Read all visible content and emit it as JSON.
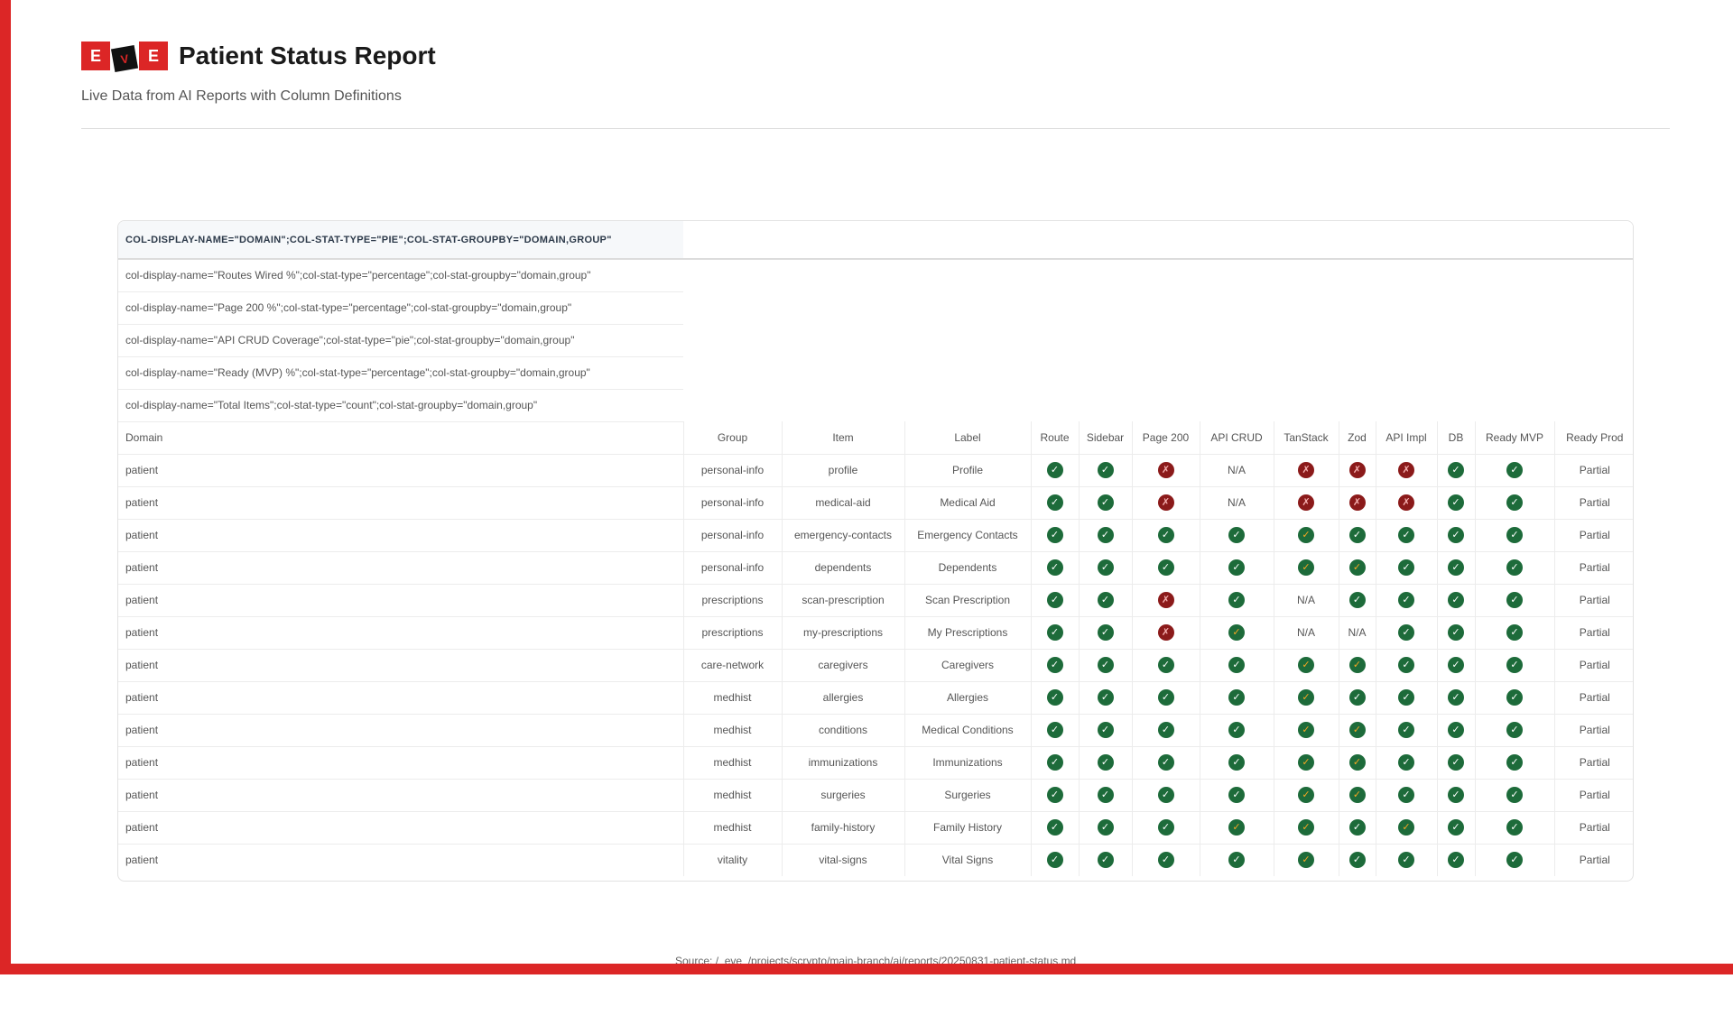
{
  "header": {
    "logo_letters": [
      "E",
      "V",
      "E"
    ],
    "title": "Patient Status Report",
    "subtitle": "Live Data from AI Reports with Column Definitions"
  },
  "table": {
    "definition_header": "COL-DISPLAY-NAME=\"DOMAIN\";COL-STAT-TYPE=\"PIE\";COL-STAT-GROUPBY=\"DOMAIN,GROUP\"",
    "definitions": [
      "col-display-name=\"Routes Wired %\";col-stat-type=\"percentage\";col-stat-groupby=\"domain,group\"",
      "col-display-name=\"Page 200 %\";col-stat-type=\"percentage\";col-stat-groupby=\"domain,group\"",
      "col-display-name=\"API CRUD Coverage\";col-stat-type=\"pie\";col-stat-groupby=\"domain,group\"",
      "col-display-name=\"Ready (MVP) %\";col-stat-type=\"percentage\";col-stat-groupby=\"domain,group\"",
      "col-display-name=\"Total Items\";col-stat-type=\"count\";col-stat-groupby=\"domain,group\""
    ],
    "columns": [
      "Domain",
      "Group",
      "Item",
      "Label",
      "Route",
      "Sidebar",
      "Page 200",
      "API CRUD",
      "TanStack",
      "Zod",
      "API Impl",
      "DB",
      "Ready MVP",
      "Ready Prod"
    ],
    "status_legend": {
      "g": "pass",
      "o": "pass-partial",
      "r": "fail"
    },
    "colors": {
      "accent": "#dc2626",
      "pass": "#1d6b3a",
      "fail": "#8b1a1a",
      "partial": "#e8741c"
    },
    "rows": [
      {
        "domain": "patient",
        "group": "personal-info",
        "item": "profile",
        "label": "Profile",
        "status": [
          "g",
          "g",
          "r",
          "N/A",
          "r",
          "r",
          "r",
          "g",
          "g"
        ],
        "prod": "Partial"
      },
      {
        "domain": "patient",
        "group": "personal-info",
        "item": "medical-aid",
        "label": "Medical Aid",
        "status": [
          "g",
          "g",
          "r",
          "N/A",
          "r",
          "r",
          "r",
          "g",
          "g"
        ],
        "prod": "Partial"
      },
      {
        "domain": "patient",
        "group": "personal-info",
        "item": "emergency-contacts",
        "label": "Emergency Contacts",
        "status": [
          "g",
          "g",
          "g",
          "g",
          "o",
          "g",
          "g",
          "g",
          "g"
        ],
        "prod": "Partial"
      },
      {
        "domain": "patient",
        "group": "personal-info",
        "item": "dependents",
        "label": "Dependents",
        "status": [
          "g",
          "g",
          "g",
          "g",
          "o",
          "o",
          "g",
          "g",
          "g"
        ],
        "prod": "Partial"
      },
      {
        "domain": "patient",
        "group": "prescriptions",
        "item": "scan-prescription",
        "label": "Scan Prescription",
        "status": [
          "g",
          "g",
          "r",
          "g",
          "N/A",
          "g",
          "g",
          "g",
          "g"
        ],
        "prod": "Partial"
      },
      {
        "domain": "patient",
        "group": "prescriptions",
        "item": "my-prescriptions",
        "label": "My Prescriptions",
        "status": [
          "g",
          "g",
          "r",
          "o",
          "N/A",
          "N/A",
          "g",
          "g",
          "g"
        ],
        "prod": "Partial"
      },
      {
        "domain": "patient",
        "group": "care-network",
        "item": "caregivers",
        "label": "Caregivers",
        "status": [
          "g",
          "g",
          "g",
          "g",
          "o",
          "o",
          "g",
          "g",
          "g"
        ],
        "prod": "Partial"
      },
      {
        "domain": "patient",
        "group": "medhist",
        "item": "allergies",
        "label": "Allergies",
        "status": [
          "g",
          "g",
          "g",
          "g",
          "o",
          "g",
          "g",
          "g",
          "g"
        ],
        "prod": "Partial"
      },
      {
        "domain": "patient",
        "group": "medhist",
        "item": "conditions",
        "label": "Medical Conditions",
        "status": [
          "g",
          "g",
          "g",
          "g",
          "o",
          "o",
          "g",
          "g",
          "g"
        ],
        "prod": "Partial"
      },
      {
        "domain": "patient",
        "group": "medhist",
        "item": "immunizations",
        "label": "Immunizations",
        "status": [
          "g",
          "g",
          "g",
          "g",
          "o",
          "o",
          "g",
          "g",
          "g"
        ],
        "prod": "Partial"
      },
      {
        "domain": "patient",
        "group": "medhist",
        "item": "surgeries",
        "label": "Surgeries",
        "status": [
          "g",
          "g",
          "g",
          "g",
          "o",
          "o",
          "g",
          "g",
          "g"
        ],
        "prod": "Partial"
      },
      {
        "domain": "patient",
        "group": "medhist",
        "item": "family-history",
        "label": "Family History",
        "status": [
          "g",
          "g",
          "g",
          "o",
          "o",
          "g",
          "o",
          "g",
          "g"
        ],
        "prod": "Partial"
      },
      {
        "domain": "patient",
        "group": "vitality",
        "item": "vital-signs",
        "label": "Vital Signs",
        "status": [
          "g",
          "g",
          "g",
          "g",
          "o",
          "g",
          "g",
          "g",
          "g"
        ],
        "prod": "Partial"
      }
    ]
  },
  "footer": {
    "source": "Source: /_eve_/projects/scrypto/main-branch/ai/reports/20250831-patient-status.md"
  }
}
